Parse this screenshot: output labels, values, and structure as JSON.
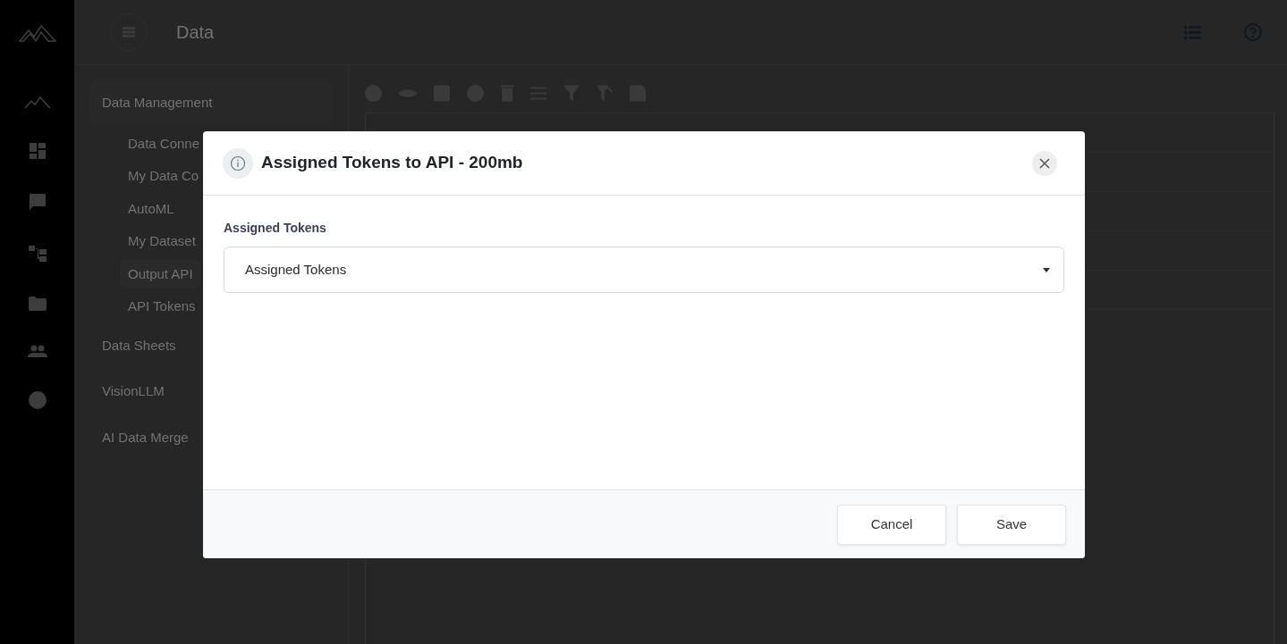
{
  "header": {
    "title": "Data"
  },
  "sidebar": {
    "sections": [
      {
        "label": "Data Management",
        "expanded": true,
        "children": [
          {
            "label": "Data Conne",
            "selected": false
          },
          {
            "label": "My Data Co",
            "selected": false
          },
          {
            "label": "AutoML",
            "selected": false
          },
          {
            "label": "My Dataset",
            "selected": false
          },
          {
            "label": "Output API",
            "selected": true
          },
          {
            "label": "API Tokens",
            "selected": false
          }
        ]
      },
      {
        "label": "Data Sheets",
        "expanded": false
      },
      {
        "label": "VisionLLM",
        "expanded": false
      },
      {
        "label": "AI Data Merge",
        "expanded": false
      }
    ]
  },
  "modal": {
    "title": "Assigned Tokens to API - 200mb",
    "field": {
      "label": "Assigned Tokens",
      "placeholder": "Assigned Tokens"
    },
    "buttons": [
      "Cancel",
      "Save"
    ]
  }
}
